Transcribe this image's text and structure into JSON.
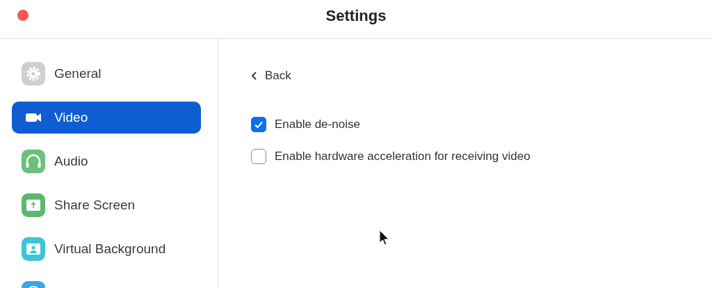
{
  "window": {
    "title": "Settings"
  },
  "sidebar": {
    "items": [
      {
        "kind": "gear",
        "label": "General",
        "selected": false
      },
      {
        "kind": "camera",
        "label": "Video",
        "selected": true
      },
      {
        "kind": "headphones",
        "label": "Audio",
        "selected": false
      },
      {
        "kind": "share",
        "label": "Share Screen",
        "selected": false
      },
      {
        "kind": "person",
        "label": "Virtual Background",
        "selected": false
      },
      {
        "kind": "record",
        "selected": false
      }
    ]
  },
  "content": {
    "back": "Back",
    "options": [
      {
        "label": "Enable de-noise",
        "checked": true
      },
      {
        "label": "Enable hardware acceleration for receiving video",
        "checked": false
      }
    ]
  }
}
